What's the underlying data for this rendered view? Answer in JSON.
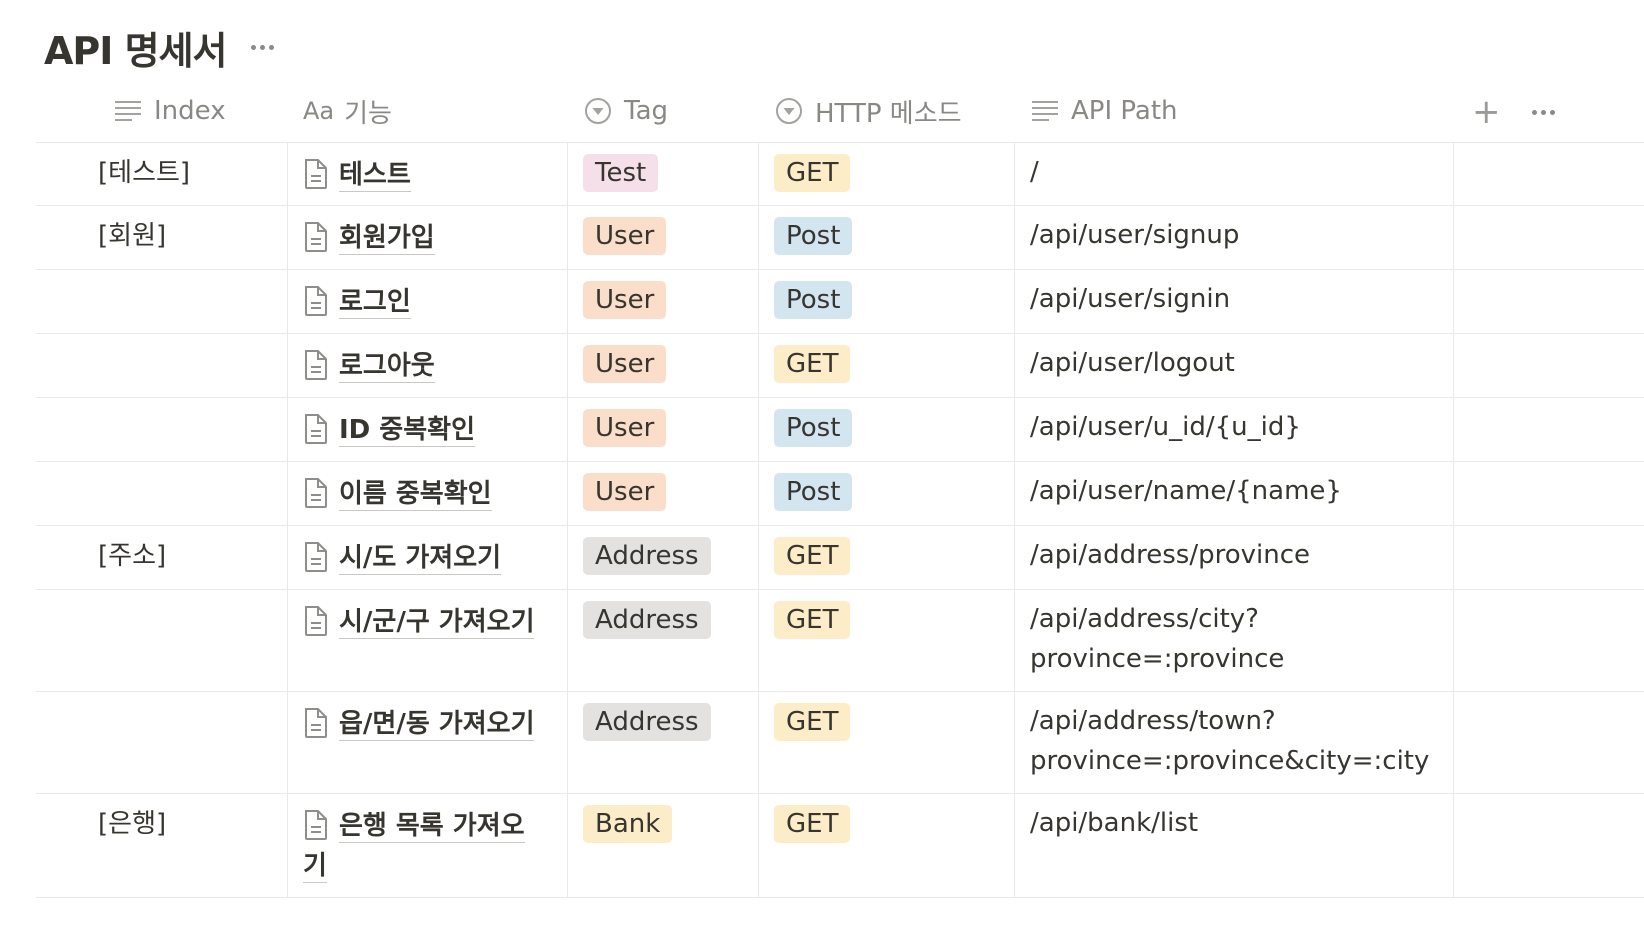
{
  "page": {
    "title": "API 명세서"
  },
  "columns": {
    "index": "Index",
    "name_prefix": "Aa",
    "name": "기능",
    "tag": "Tag",
    "method": "HTTP 메소드",
    "path": "API Path"
  },
  "colors": {
    "Test": "#f5e0e9",
    "User": "#fadec9",
    "Address": "#e3e2e0",
    "Bank": "#fdecc8",
    "GET": "#fdecc8",
    "Post": "#d3e5ef"
  },
  "rows": [
    {
      "index": "[테스트]",
      "name": "테스트",
      "tag": "Test",
      "method": "GET",
      "path": "/"
    },
    {
      "index": "[회원]",
      "name": "회원가입",
      "tag": "User",
      "method": "Post",
      "path": "/api/user/signup"
    },
    {
      "index": "",
      "name": "로그인",
      "tag": "User",
      "method": "Post",
      "path": "/api/user/signin"
    },
    {
      "index": "",
      "name": "로그아웃",
      "tag": "User",
      "method": "GET",
      "path": "/api/user/logout"
    },
    {
      "index": "",
      "name": "ID 중복확인",
      "tag": "User",
      "method": "Post",
      "path": "/api/user/u_id/{u_id}"
    },
    {
      "index": "",
      "name": "이름 중복확인",
      "tag": "User",
      "method": "Post",
      "path": "/api/user/name/{name}"
    },
    {
      "index": "[주소]",
      "name": "시/도 가져오기",
      "tag": "Address",
      "method": "GET",
      "path": "/api/address/province"
    },
    {
      "index": "",
      "name": "시/군/구 가져오기",
      "tag": "Address",
      "method": "GET",
      "path": "/api/address/city?province=:province"
    },
    {
      "index": "",
      "name": "읍/면/동 가져오기",
      "tag": "Address",
      "method": "GET",
      "path": "/api/address/town?province=:province&city=:city"
    },
    {
      "index": "[은행]",
      "name": "은행 목록 가져오기",
      "tag": "Bank",
      "method": "GET",
      "path": "/api/bank/list"
    }
  ]
}
